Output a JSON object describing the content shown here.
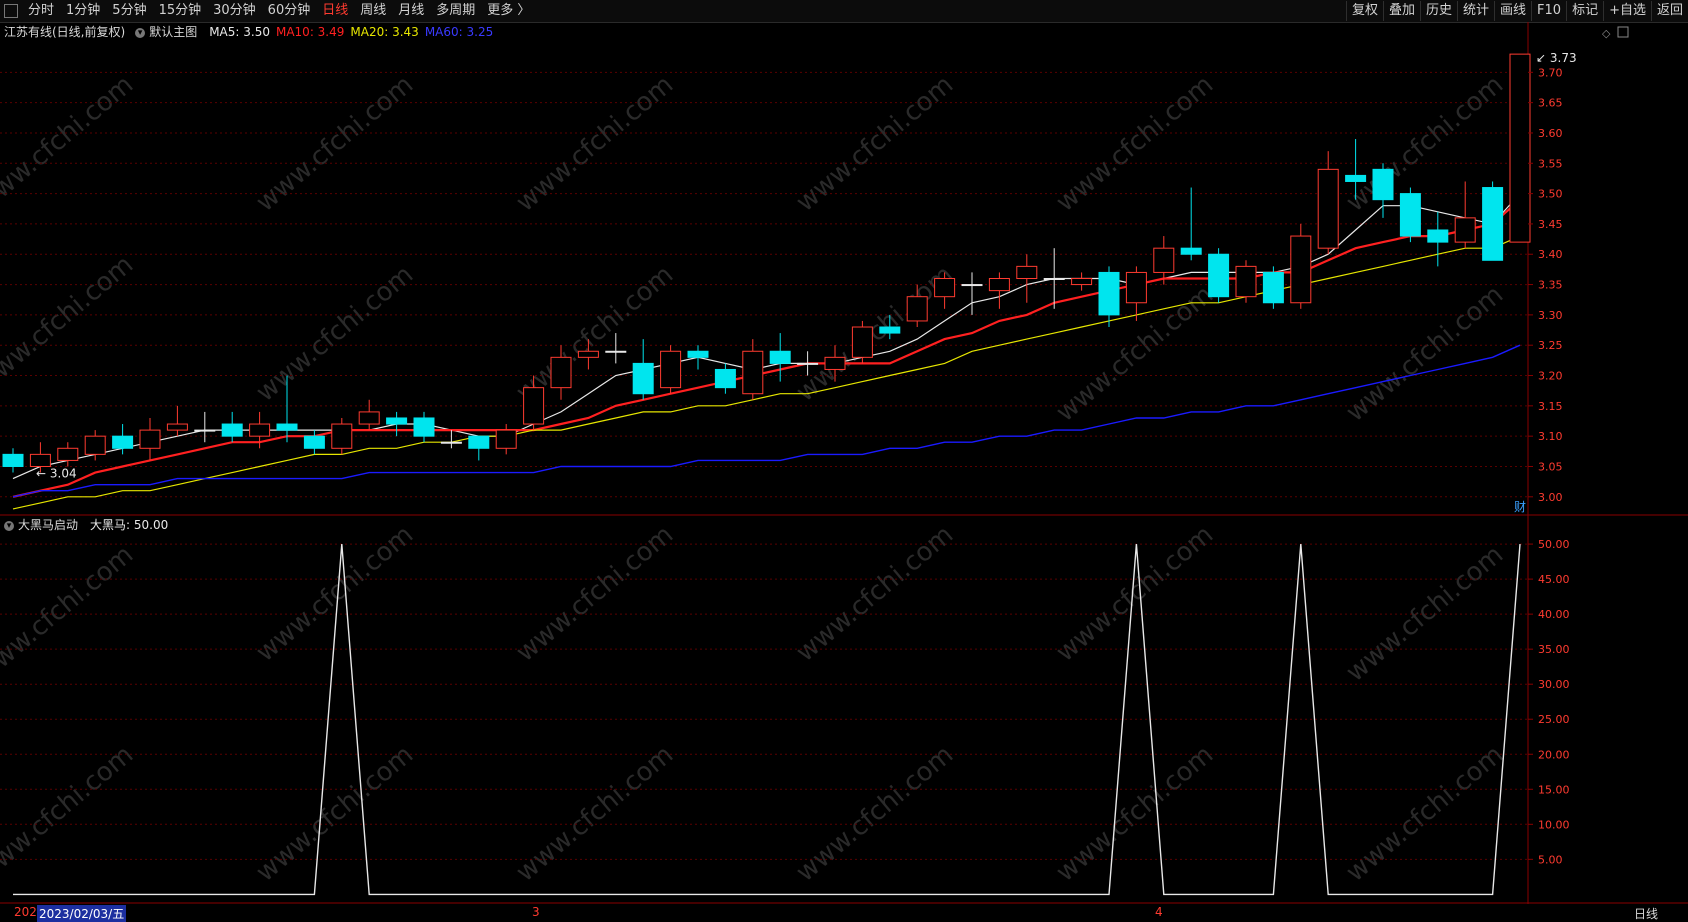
{
  "toolbar": {
    "periods": [
      "分时",
      "1分钟",
      "5分钟",
      "15分钟",
      "30分钟",
      "60分钟",
      "日线",
      "周线",
      "月线",
      "多周期",
      "更多 〉"
    ],
    "active_period": "日线",
    "right_buttons": [
      "复权",
      "叠加",
      "历史",
      "统计",
      "画线",
      "F10",
      "标记",
      "+自选",
      "返回"
    ]
  },
  "main_info": {
    "title": "江苏有线(日线,前复权)",
    "template": "默认主图",
    "ma5": "MA5: 3.50",
    "ma10": "MA10: 3.49",
    "ma20": "MA20: 3.43",
    "ma60": "MA60: 3.25"
  },
  "indicator_info": {
    "name": "大黑马启动",
    "value": "大黑马: 50.00"
  },
  "annotations": {
    "high_label": "3.73",
    "low_label": "← 3.04",
    "finance_marker": "财"
  },
  "axis": {
    "price_ticks": [
      "3.70",
      "3.65",
      "3.60",
      "3.55",
      "3.50",
      "3.45",
      "3.40",
      "3.35",
      "3.30",
      "3.25",
      "3.20",
      "3.15",
      "3.10",
      "3.05",
      "3.00"
    ],
    "indicator_ticks": [
      "50.00",
      "45.00",
      "40.00",
      "35.00",
      "30.00",
      "25.00",
      "20.00",
      "15.00",
      "10.00",
      "5.00"
    ]
  },
  "date_bar": {
    "year_prefix": "202",
    "current_date": "2023/02/03/五",
    "month_labels": [
      "3",
      "4"
    ],
    "period_label": "日线"
  },
  "watermark": "www.cfchi.com",
  "colors": {
    "up": "#ff3b30",
    "down": "#00e5ee",
    "ma5": "#e8e8e8",
    "ma10": "#ff2020",
    "ma20": "#e6e600",
    "ma60": "#1a1aff",
    "grid": "#5a0000",
    "indicator_line": "#e8e8e8"
  },
  "chart_data": [
    {
      "type": "candlestick",
      "title": "江苏有线(日线,前复权)",
      "ylim": [
        2.97,
        3.75
      ],
      "series": [
        {
          "name": "K线",
          "values": [
            [
              3.07,
              3.05,
              3.08,
              3.04
            ],
            [
              3.05,
              3.07,
              3.09,
              3.04
            ],
            [
              3.06,
              3.08,
              3.09,
              3.05
            ],
            [
              3.07,
              3.1,
              3.11,
              3.06
            ],
            [
              3.1,
              3.08,
              3.12,
              3.07
            ],
            [
              3.08,
              3.11,
              3.13,
              3.06
            ],
            [
              3.11,
              3.12,
              3.15,
              3.1
            ],
            [
              3.11,
              3.11,
              3.14,
              3.09
            ],
            [
              3.12,
              3.1,
              3.14,
              3.09
            ],
            [
              3.1,
              3.12,
              3.14,
              3.08
            ],
            [
              3.12,
              3.11,
              3.2,
              3.09
            ],
            [
              3.1,
              3.08,
              3.11,
              3.07
            ],
            [
              3.08,
              3.12,
              3.13,
              3.07
            ],
            [
              3.12,
              3.14,
              3.16,
              3.11
            ],
            [
              3.13,
              3.12,
              3.14,
              3.1
            ],
            [
              3.13,
              3.1,
              3.14,
              3.09
            ],
            [
              3.09,
              3.09,
              3.11,
              3.08
            ],
            [
              3.1,
              3.08,
              3.1,
              3.06
            ],
            [
              3.08,
              3.11,
              3.12,
              3.07
            ],
            [
              3.12,
              3.18,
              3.2,
              3.11
            ],
            [
              3.18,
              3.23,
              3.25,
              3.16
            ],
            [
              3.23,
              3.24,
              3.26,
              3.21
            ],
            [
              3.24,
              3.24,
              3.27,
              3.22
            ],
            [
              3.22,
              3.17,
              3.26,
              3.16
            ],
            [
              3.18,
              3.24,
              3.25,
              3.17
            ],
            [
              3.24,
              3.23,
              3.25,
              3.21
            ],
            [
              3.21,
              3.18,
              3.22,
              3.17
            ],
            [
              3.17,
              3.24,
              3.26,
              3.16
            ],
            [
              3.24,
              3.22,
              3.27,
              3.19
            ],
            [
              3.22,
              3.22,
              3.24,
              3.2
            ],
            [
              3.21,
              3.23,
              3.25,
              3.19
            ],
            [
              3.23,
              3.28,
              3.29,
              3.22
            ],
            [
              3.28,
              3.27,
              3.3,
              3.26
            ],
            [
              3.29,
              3.33,
              3.35,
              3.28
            ],
            [
              3.33,
              3.36,
              3.37,
              3.31
            ],
            [
              3.35,
              3.35,
              3.37,
              3.3
            ],
            [
              3.34,
              3.36,
              3.37,
              3.31
            ],
            [
              3.36,
              3.38,
              3.4,
              3.32
            ],
            [
              3.36,
              3.36,
              3.41,
              3.31
            ],
            [
              3.35,
              3.36,
              3.37,
              3.34
            ],
            [
              3.37,
              3.3,
              3.38,
              3.28
            ],
            [
              3.32,
              3.37,
              3.38,
              3.29
            ],
            [
              3.37,
              3.41,
              3.43,
              3.35
            ],
            [
              3.41,
              3.4,
              3.51,
              3.39
            ],
            [
              3.4,
              3.33,
              3.41,
              3.32
            ],
            [
              3.33,
              3.38,
              3.39,
              3.32
            ],
            [
              3.37,
              3.32,
              3.38,
              3.31
            ],
            [
              3.32,
              3.43,
              3.45,
              3.31
            ],
            [
              3.41,
              3.54,
              3.57,
              3.4
            ],
            [
              3.53,
              3.52,
              3.59,
              3.49
            ],
            [
              3.54,
              3.49,
              3.55,
              3.46
            ],
            [
              3.5,
              3.43,
              3.51,
              3.42
            ],
            [
              3.44,
              3.42,
              3.47,
              3.38
            ],
            [
              3.42,
              3.46,
              3.52,
              3.41
            ],
            [
              3.51,
              3.39,
              3.52,
              3.39
            ],
            [
              3.42,
              3.73,
              3.73,
              3.42
            ]
          ]
        },
        {
          "name": "MA5",
          "values": [
            3.03,
            3.05,
            3.06,
            3.07,
            3.08,
            3.09,
            3.1,
            3.11,
            3.11,
            3.11,
            3.11,
            3.11,
            3.11,
            3.11,
            3.12,
            3.12,
            3.11,
            3.1,
            3.1,
            3.12,
            3.14,
            3.17,
            3.2,
            3.21,
            3.22,
            3.23,
            3.22,
            3.21,
            3.22,
            3.22,
            3.22,
            3.23,
            3.24,
            3.26,
            3.29,
            3.32,
            3.33,
            3.35,
            3.36,
            3.36,
            3.36,
            3.35,
            3.36,
            3.37,
            3.37,
            3.37,
            3.37,
            3.38,
            3.4,
            3.44,
            3.48,
            3.48,
            3.47,
            3.46,
            3.45,
            3.5
          ]
        },
        {
          "name": "MA10",
          "values": [
            3.0,
            3.01,
            3.02,
            3.04,
            3.05,
            3.06,
            3.07,
            3.08,
            3.09,
            3.09,
            3.1,
            3.1,
            3.11,
            3.11,
            3.11,
            3.11,
            3.11,
            3.11,
            3.11,
            3.11,
            3.12,
            3.13,
            3.15,
            3.16,
            3.17,
            3.18,
            3.19,
            3.2,
            3.21,
            3.22,
            3.22,
            3.22,
            3.22,
            3.24,
            3.26,
            3.27,
            3.29,
            3.3,
            3.32,
            3.33,
            3.34,
            3.35,
            3.36,
            3.36,
            3.36,
            3.36,
            3.37,
            3.37,
            3.39,
            3.41,
            3.42,
            3.43,
            3.43,
            3.44,
            3.45,
            3.49
          ]
        },
        {
          "name": "MA20",
          "values": [
            2.98,
            2.99,
            3.0,
            3.0,
            3.01,
            3.01,
            3.02,
            3.03,
            3.04,
            3.05,
            3.06,
            3.07,
            3.07,
            3.08,
            3.08,
            3.09,
            3.09,
            3.1,
            3.1,
            3.11,
            3.11,
            3.12,
            3.13,
            3.14,
            3.14,
            3.15,
            3.15,
            3.16,
            3.17,
            3.17,
            3.18,
            3.19,
            3.2,
            3.21,
            3.22,
            3.24,
            3.25,
            3.26,
            3.27,
            3.28,
            3.29,
            3.3,
            3.31,
            3.32,
            3.32,
            3.33,
            3.34,
            3.35,
            3.36,
            3.37,
            3.38,
            3.39,
            3.4,
            3.41,
            3.41,
            3.43
          ]
        },
        {
          "name": "MA60",
          "values": [
            3.0,
            3.01,
            3.01,
            3.02,
            3.02,
            3.02,
            3.03,
            3.03,
            3.03,
            3.03,
            3.03,
            3.03,
            3.03,
            3.04,
            3.04,
            3.04,
            3.04,
            3.04,
            3.04,
            3.04,
            3.05,
            3.05,
            3.05,
            3.05,
            3.05,
            3.06,
            3.06,
            3.06,
            3.06,
            3.07,
            3.07,
            3.07,
            3.08,
            3.08,
            3.09,
            3.09,
            3.1,
            3.1,
            3.11,
            3.11,
            3.12,
            3.13,
            3.13,
            3.14,
            3.14,
            3.15,
            3.15,
            3.16,
            3.17,
            3.18,
            3.19,
            3.2,
            3.21,
            3.22,
            3.23,
            3.25
          ]
        }
      ]
    },
    {
      "type": "line",
      "title": "大黑马启动",
      "ylim": [
        0,
        50
      ],
      "series": [
        {
          "name": "大黑马",
          "values": [
            0,
            0,
            0,
            0,
            0,
            0,
            0,
            0,
            0,
            0,
            0,
            0,
            50,
            0,
            0,
            0,
            0,
            0,
            0,
            0,
            0,
            0,
            0,
            0,
            0,
            0,
            0,
            0,
            0,
            0,
            0,
            0,
            0,
            0,
            0,
            0,
            0,
            0,
            0,
            0,
            0,
            50,
            0,
            0,
            0,
            0,
            0,
            50,
            0,
            0,
            0,
            0,
            0,
            0,
            0,
            50
          ]
        }
      ]
    }
  ]
}
